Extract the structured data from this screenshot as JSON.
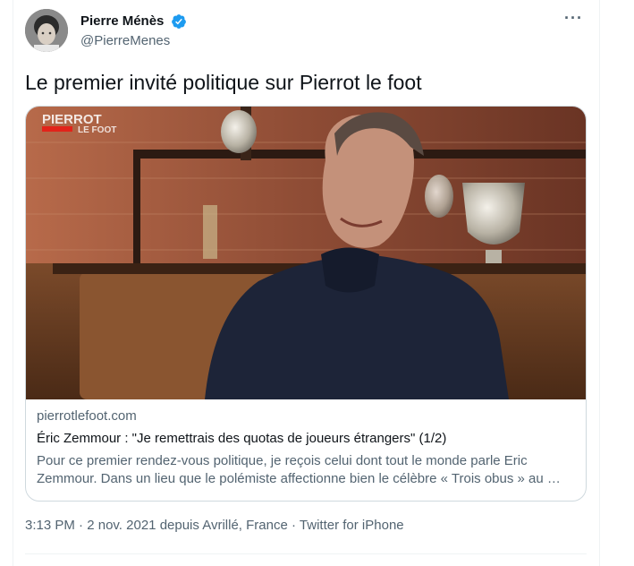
{
  "author": {
    "display_name": "Pierre Ménès",
    "handle": "@PierreMenes",
    "verified": true
  },
  "more_label": "···",
  "tweet": {
    "text": "Le premier invité politique sur Pierrot le foot"
  },
  "card": {
    "image_overlay_logo": "PIERROT LE FOOT",
    "domain": "pierrotlefoot.com",
    "title": "Éric Zemmour : \"Je remettrais des quotas de joueurs étrangers\" (1/2)",
    "description": "Pour ce premier rendez-vous politique, je reçois celui dont tout le monde parle Eric Zemmour. Dans un lieu que le polémiste affectionne bien le célèbre « Trois obus » au …"
  },
  "meta": {
    "time": "3:13 PM",
    "date": "2 nov. 2021",
    "location": "depuis Avrillé, France",
    "source": "Twitter for iPhone",
    "separator": "·"
  },
  "colors": {
    "verified_blue": "#1d9bf0",
    "text_primary": "#0f1419",
    "text_secondary": "#536471",
    "border": "#cfd9de"
  }
}
